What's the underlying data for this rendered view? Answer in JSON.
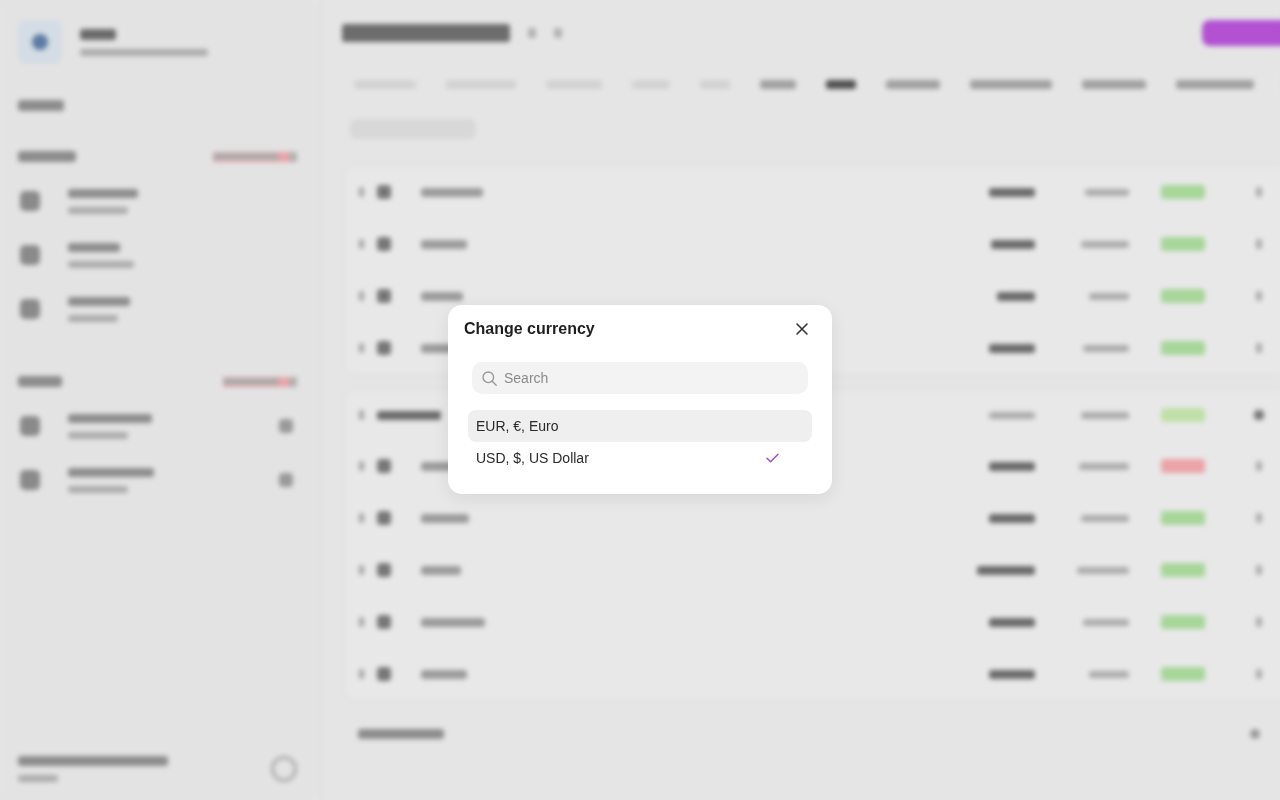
{
  "dialog": {
    "title": "Change currency",
    "search": {
      "placeholder": "Search"
    },
    "options": [
      {
        "label": "EUR, €, Euro",
        "selected": false,
        "hovered": true
      },
      {
        "label": "USD, $, US Dollar",
        "selected": true,
        "hovered": false
      }
    ]
  }
}
